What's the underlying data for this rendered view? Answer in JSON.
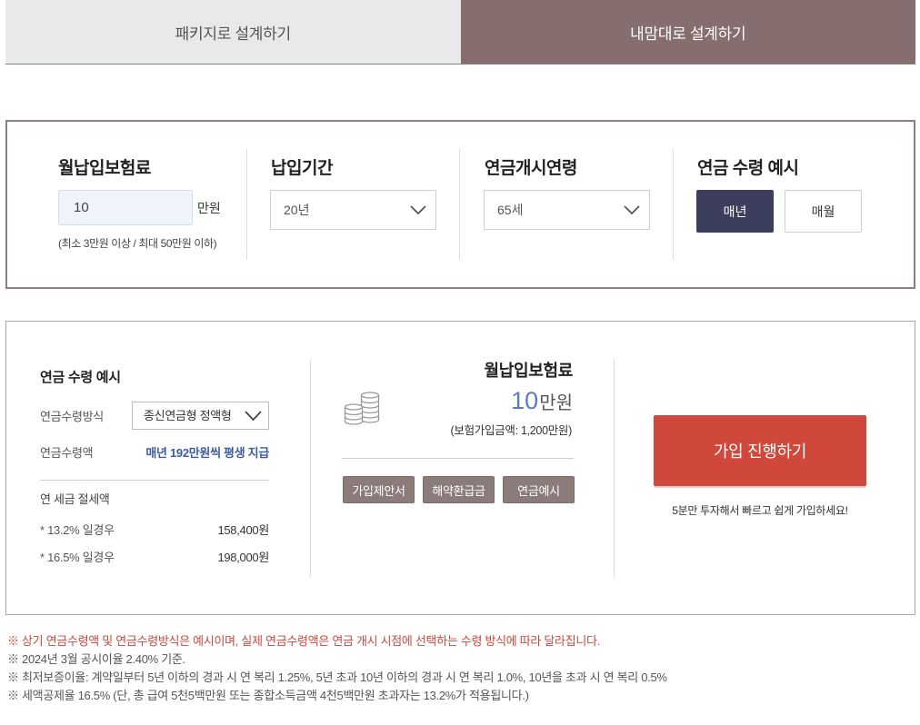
{
  "colors": {
    "tab_inactive_bg": "#e9e9e9",
    "tab_active_bg": "#876e6e",
    "frame_border": "#8e7e7e",
    "toggle_active_bg": "#3c3e5e",
    "highlight_blue": "#3b5ca5",
    "amount_blue": "#5a7cc4",
    "doc_button_bg": "#8b7b7b",
    "cta_red": "#d0483b",
    "notice_red": "#c9483c"
  },
  "tabs": [
    {
      "label": "패키지로 설계하기",
      "active": false
    },
    {
      "label": "내맘대로 설계하기",
      "active": true
    }
  ],
  "design": {
    "monthly_premium": {
      "title": "월납입보험료",
      "value": "10",
      "unit": "만원",
      "hint": "(최소 3만원 이상 / 최대 50만원 이하)"
    },
    "payment_period": {
      "title": "납입기간",
      "selected": "20년",
      "icon": "chevron-down-icon"
    },
    "start_age": {
      "title": "연금개시연령",
      "selected": "65세",
      "icon": "chevron-down-icon"
    },
    "payout_example": {
      "title": "연금 수령 예시",
      "options": [
        {
          "label": "매년",
          "active": true
        },
        {
          "label": "매월",
          "active": false
        }
      ]
    }
  },
  "result": {
    "summary": {
      "title": "연금 수령 예시",
      "method_label": "연금수령방식",
      "method_selected": "종신연금형 정액형",
      "amount_label": "연금수령액",
      "amount_value": "매년 192만원씩 평생 지급",
      "tax_title": "연 세금 절세액",
      "tax_rows": [
        {
          "label": "* 13.2% 일경우",
          "value": "158,400원"
        },
        {
          "label": "* 16.5% 일경우",
          "value": "198,000원"
        }
      ]
    },
    "premium": {
      "icon": "coin-stack-icon",
      "title": "월납입보험료",
      "amount": "10",
      "unit": "만원",
      "coverage": "(보험가입금액: 1,200만원)",
      "buttons": [
        "가입제안서",
        "해약환급금",
        "연금예시"
      ]
    },
    "join": {
      "button": "가입 진행하기",
      "caption": "5분만 투자해서 빠르고 쉽게 가입하세요!"
    }
  },
  "notes": [
    {
      "text": "※ 상기 연금수령액 및 연금수령방식은 예시이며, 실제 연금수령액은 연금 개시 시점에 선택하는 수령 방식에 따라 달라집니다.",
      "emphasis": true
    },
    {
      "text": "※ 2024년 3월 공시이율 2.40% 기준.",
      "emphasis": false
    },
    {
      "text": "※ 최저보증이율: 계약일부터 5년 이하의 경과 시 연 복리 1.25%, 5년 초과 10년 이하의 경과 시 연 복리 1.0%, 10년을 초과 시 연 복리 0.5%",
      "emphasis": false
    },
    {
      "text": "※ 세액공제율 16.5% (단, 총 급여 5천5백만원 또는 종합소득금액 4천5백만원 초과자는 13.2%가 적용됩니다.)",
      "emphasis": false
    }
  ]
}
